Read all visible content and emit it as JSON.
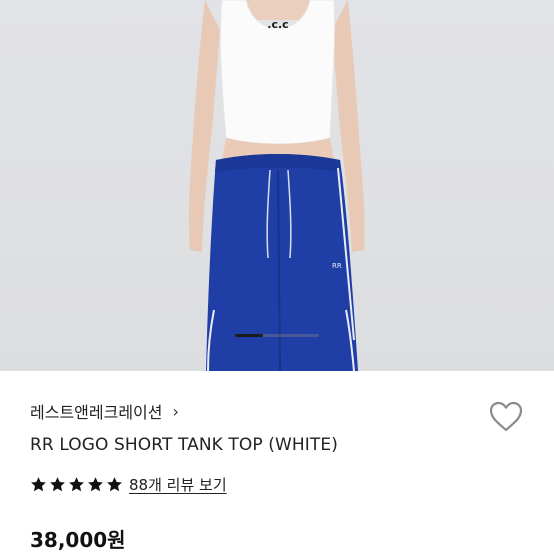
{
  "product": {
    "brand": "레스트앤레크레이션",
    "brand_chevron": "›",
    "name": "RR LOGO SHORT TANK TOP (WHITE)",
    "rating": 5,
    "review_link": "88개 리뷰 보기",
    "price": "38,000원"
  },
  "gallery": {
    "current_index": 1,
    "total": 3
  },
  "icons": {
    "wishlist": "heart-outline-icon",
    "star": "star-icon",
    "brand_link": "chevron-right-icon"
  },
  "colors": {
    "star": "#111111",
    "heart_stroke": "#8a8a8a",
    "pants": "#1f3fa6",
    "tank": "#fbfbfb"
  }
}
